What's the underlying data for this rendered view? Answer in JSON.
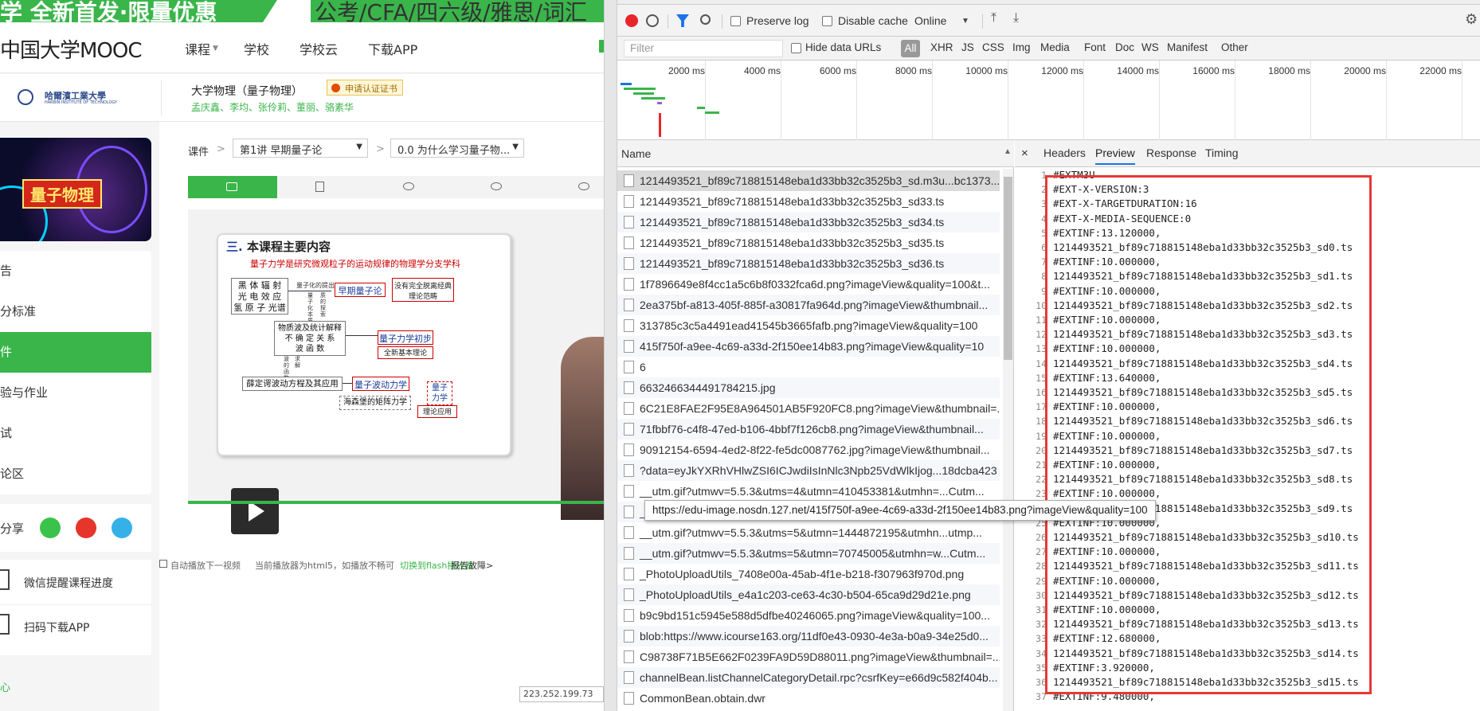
{
  "site": {
    "banner_left": "学 全新首发·限量优惠",
    "banner_right": "公考/CFA/四六级/雅思/词汇",
    "logo": "中国大学MOOC",
    "nav": [
      "课程",
      "学校",
      "学校云",
      "下载APP"
    ],
    "school_logo_text": "哈爾濱工業大學",
    "school_logo_sub": "HARBIN INSTITUTE OF TECHNOLOGY",
    "course_title": "大学物理（量子物理）",
    "certificate_btn": "申请认证证书",
    "teachers": "孟庆鑫、李均、张伶莉、董丽、骆素华",
    "cover_label": "量子物理",
    "side_menu": [
      "告",
      "分标准",
      "件",
      "验与作业",
      "试",
      "论区"
    ],
    "active_menu_index": 2,
    "share_label": "分享",
    "wx_progress": "微信提醒课程进度",
    "scan_download": "扫码下载APP",
    "bottom_left": "心",
    "breadcrumb_root": "课件",
    "lesson_select": "第1讲 早期量子论",
    "unit_select": "0.0 为什么学习量子物...",
    "slide": {
      "heading_num": "三.",
      "heading": "本课程主要内容",
      "subtitle": "量子力学是研究微观粒子的运动规律的物理学分支学科",
      "b1": "黑 体 辐 射\n光 电 效 应\n氢 原 子 光谱",
      "r1": "量子化的提出",
      "v1": "量子化本质",
      "v1b": "质的探索",
      "early": "早期量子论",
      "nofull": "没有完全脱离经典\n理论范畴",
      "b2": "物质波及统计解释\n不 确 定 关 系\n波      函      数",
      "qm_intro": "量子力学初步",
      "newbasic": "全新基本理论",
      "v2": "波的函数",
      "v2b": "求解",
      "b3": "薛定谔波动方程及其应用",
      "wave": "量子波动力学",
      "matrix": "海森堡的矩阵力学",
      "qm": "量子\n力学",
      "app": "理论应用"
    },
    "autoplay": "自动播放下一视频",
    "player_info": "当前播放器为html5，如播放不畅可",
    "switch_flash": "切换到flash播放器",
    "report": "报告故障>",
    "ip": "223.252.199.73"
  },
  "devtools": {
    "toolbar": {
      "preserve_log": "Preserve log",
      "disable_cache": "Disable cache",
      "throttle": "Online"
    },
    "filter": {
      "placeholder": "Filter",
      "hide_data_urls": "Hide data URLs",
      "types": [
        "All",
        "XHR",
        "JS",
        "CSS",
        "Img",
        "Media",
        "Font",
        "Doc",
        "WS",
        "Manifest",
        "Other"
      ]
    },
    "timeline_ticks": [
      "2000 ms",
      "4000 ms",
      "6000 ms",
      "8000 ms",
      "10000 ms",
      "12000 ms",
      "14000 ms",
      "16000 ms",
      "18000 ms",
      "20000 ms",
      "22000 ms"
    ],
    "name_header": "Name",
    "requests": [
      "1214493521_bf89c718815148eba1d33bb32c3525b3_sd.m3u...bc1373...",
      "1214493521_bf89c718815148eba1d33bb32c3525b3_sd33.ts",
      "1214493521_bf89c718815148eba1d33bb32c3525b3_sd34.ts",
      "1214493521_bf89c718815148eba1d33bb32c3525b3_sd35.ts",
      "1214493521_bf89c718815148eba1d33bb32c3525b3_sd36.ts",
      "1f7896649e8f4cc1a5c6b8f0332fca6d.png?imageView&quality=100&t...",
      "2ea375bf-a813-405f-885f-a30817fa964d.png?imageView&thumbnail...",
      "313785c3c5a4491ead41545b3665fafb.png?imageView&quality=100",
      "415f750f-a9ee-4c69-a33d-2f150ee14b83.png?imageView&quality=10",
      "6",
      "6632466344491784215.jpg",
      "6C21E8FAE2F95E8A964501AB5F920FC8.png?imageView&thumbnail=...",
      "71fbbf76-c4f8-47ed-b106-4bbf7f126cb8.png?imageView&thumbnail...",
      "90912154-6594-4ed2-8f22-fe5dc0087762.jpg?imageView&thumbnail...",
      "?data=eyJkYXRhVHlwZSI6ICJwdiIsInNlc3Npb25VdWlkIjog...18dcba423",
      "__utm.gif?utmwv=5.5.3&utms=4&utmn=410453381&utmhn=...Cutm...",
      "__utm.gif?utmwv=5.5.3&utms=4&utmn=73768876&utmhn=w...learn...",
      "__utm.gif?utmwv=5.5.3&utms=5&utmn=1444872195&utmhn...utmp...",
      "__utm.gif?utmwv=5.5.3&utms=5&utmn=70745005&utmhn=w...Cutm...",
      "_PhotoUploadUtils_7408e00a-45ab-4f1e-b218-f307963f970d.png",
      "_PhotoUploadUtils_e4a1c203-ce63-4c30-b504-65ca9d29d21e.png",
      "b9c9bd151c5945e588d5dfbe40246065.png?imageView&quality=100...",
      "blob:https://www.icourse163.org/11df0e43-0930-4e3a-b0a9-34e25d0...",
      "C98738F71B5E662F0239FA9D59D88011.png?imageView&thumbnail=...",
      "channelBean.listChannelCategoryDetail.rpc?csrfKey=e66d9c582f404b...",
      "CommonBean.obtain.dwr"
    ],
    "tooltip": "https://edu-image.nosdn.127.net/415f750f-a9ee-4c69-a33d-2f150ee14b83.png?imageView&quality=100",
    "detail_tabs": [
      "Headers",
      "Preview",
      "Response",
      "Timing"
    ],
    "active_detail_tab": "Preview",
    "preview_lines": [
      "#EXTM3U",
      "#EXT-X-VERSION:3",
      "#EXT-X-TARGETDURATION:16",
      "#EXT-X-MEDIA-SEQUENCE:0",
      "#EXTINF:13.120000,",
      "1214493521_bf89c718815148eba1d33bb32c3525b3_sd0.ts",
      "#EXTINF:10.000000,",
      "1214493521_bf89c718815148eba1d33bb32c3525b3_sd1.ts",
      "#EXTINF:10.000000,",
      "1214493521_bf89c718815148eba1d33bb32c3525b3_sd2.ts",
      "#EXTINF:10.000000,",
      "1214493521_bf89c718815148eba1d33bb32c3525b3_sd3.ts",
      "#EXTINF:10.000000,",
      "1214493521_bf89c718815148eba1d33bb32c3525b3_sd4.ts",
      "#EXTINF:13.640000,",
      "1214493521_bf89c718815148eba1d33bb32c3525b3_sd5.ts",
      "#EXTINF:10.000000,",
      "1214493521_bf89c718815148eba1d33bb32c3525b3_sd6.ts",
      "#EXTINF:10.000000,",
      "1214493521_bf89c718815148eba1d33bb32c3525b3_sd7.ts",
      "#EXTINF:10.000000,",
      "1214493521_bf89c718815148eba1d33bb32c3525b3_sd8.ts",
      "#EXTINF:10.000000,",
      "1214493521_bf89c718815148eba1d33bb32c3525b3_sd9.ts",
      "#EXTINF:10.000000,",
      "1214493521_bf89c718815148eba1d33bb32c3525b3_sd10.ts",
      "#EXTINF:10.000000,",
      "1214493521_bf89c718815148eba1d33bb32c3525b3_sd11.ts",
      "#EXTINF:10.000000,",
      "1214493521_bf89c718815148eba1d33bb32c3525b3_sd12.ts",
      "#EXTINF:10.000000,",
      "1214493521_bf89c718815148eba1d33bb32c3525b3_sd13.ts",
      "#EXTINF:12.680000,",
      "1214493521_bf89c718815148eba1d33bb32c3525b3_sd14.ts",
      "#EXTINF:3.920000,",
      "1214493521_bf89c718815148eba1d33bb32c3525b3_sd15.ts",
      "#EXTINF:9.480000,"
    ],
    "colors": {
      "accent_green": "#39b54a",
      "record_red": "#e8262a",
      "filter_blue": "#1a73e8",
      "highlight_box": "#e53935"
    }
  }
}
